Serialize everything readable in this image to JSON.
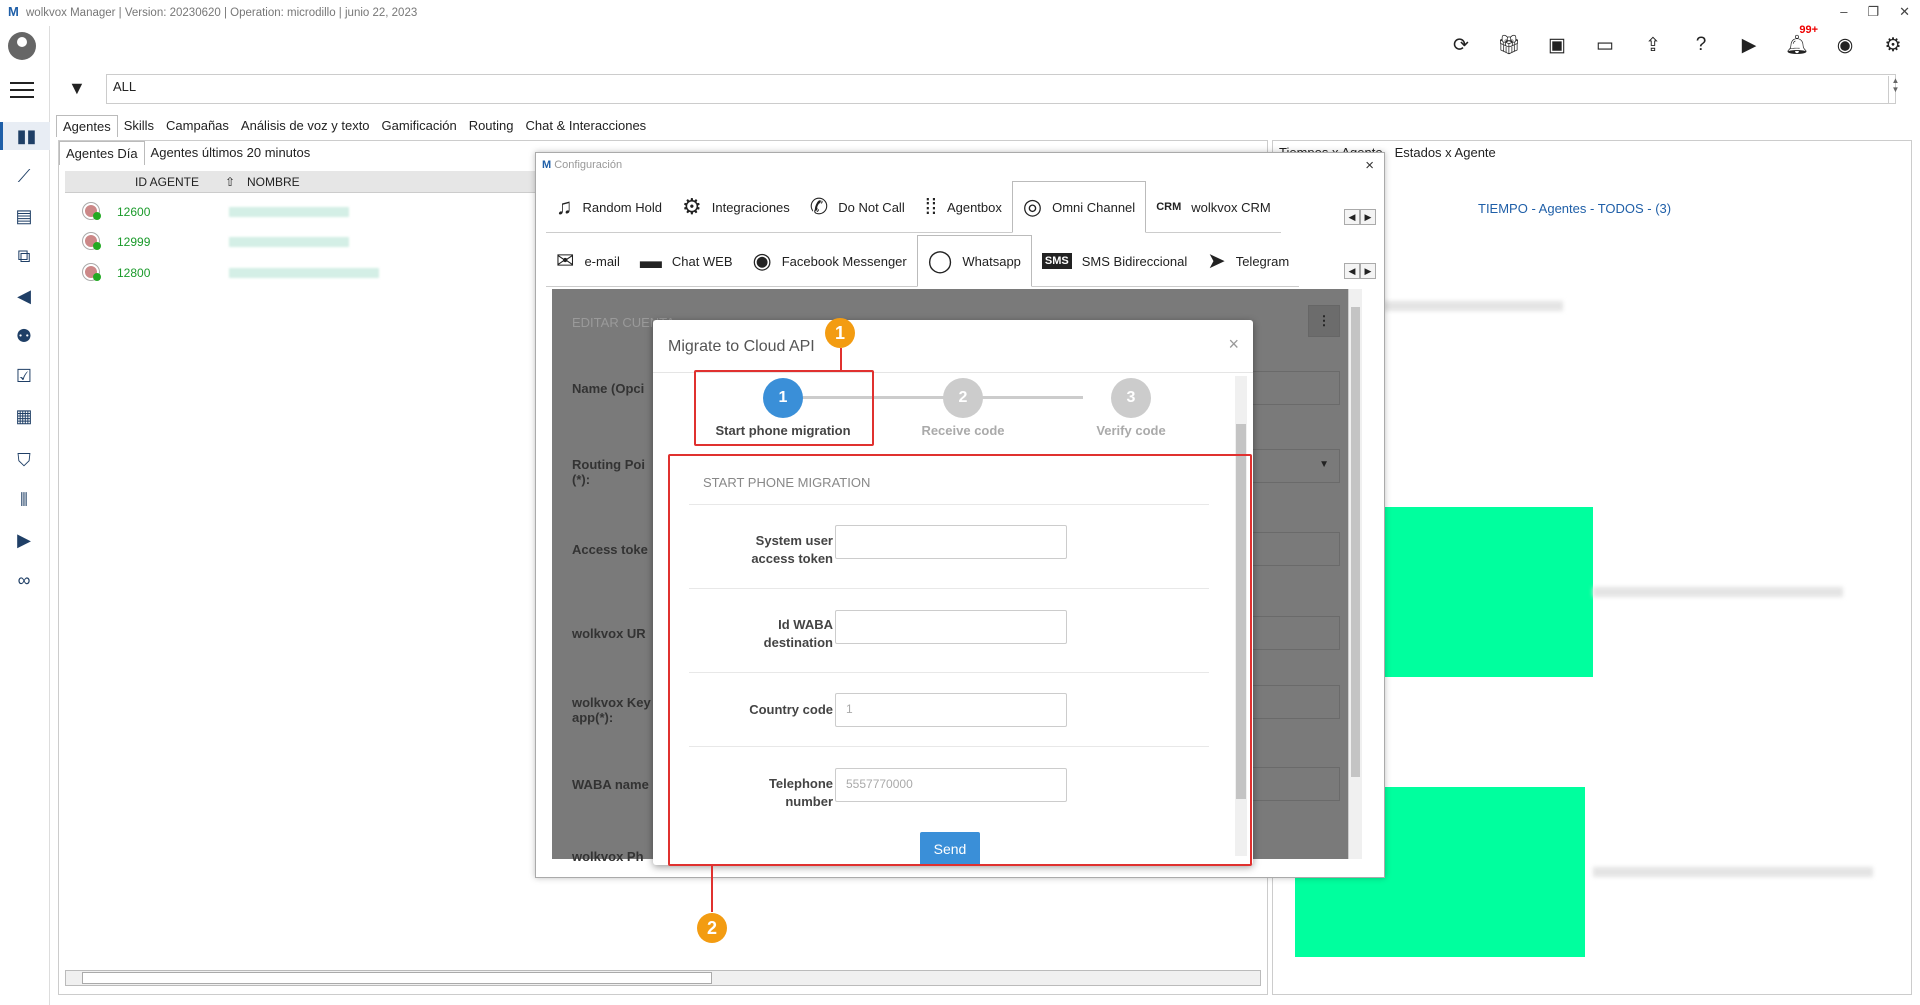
{
  "app": {
    "logo": "M",
    "title": "wolkvox Manager  | Version: 20230620 |  Operation: microdillo  |  junio 22, 2023",
    "window_buttons": [
      "–",
      "❐",
      "✕"
    ]
  },
  "toolbar": {
    "notification_badge": "99+"
  },
  "filter": {
    "value": "ALL"
  },
  "main_tabs": [
    "Agentes",
    "Skills",
    "Campañas",
    "Análisis de voz y texto",
    "Gamificación",
    "Routing",
    "Chat & Interacciones"
  ],
  "left_panel": {
    "subtabs": [
      "Agentes Día",
      "Agentes últimos 20 minutos"
    ],
    "columns": [
      "ID AGENTE",
      "NOMBRE"
    ],
    "rows": [
      {
        "id": "12600"
      },
      {
        "id": "12999"
      },
      {
        "id": "12800"
      }
    ]
  },
  "right_panel": {
    "tabs": [
      "Tiempos x Agente",
      "Estados x Agente"
    ],
    "chart_title": "TIEMPO - Agentes - TODOS -  (3)"
  },
  "config": {
    "title_logo": "M",
    "title": "Configuración",
    "close": "×",
    "tabs_row1": [
      "Random Hold",
      "Integraciones",
      "Do Not Call",
      "Agentbox",
      "Omni Channel",
      "wolkvox CRM"
    ],
    "tabs_row2": [
      "e-mail",
      "Chat WEB",
      "Facebook Messenger",
      "Whatsapp",
      "SMS Bidireccional",
      "Telegram"
    ],
    "body_header": "EDITAR CUENTA",
    "labels": [
      "Name (Opci",
      "Routing Poi\n(*):",
      "Access toke",
      "wolkvox UR",
      "wolkvox Key\napp(*):",
      "WABA name",
      "wolkvox Ph"
    ]
  },
  "modal": {
    "title": "Migrate to Cloud API",
    "close": "×",
    "steps": [
      {
        "number": "1",
        "label": "Start phone migration"
      },
      {
        "number": "2",
        "label": "Receive code"
      },
      {
        "number": "3",
        "label": "Verify code"
      }
    ],
    "section_title": "START PHONE MIGRATION",
    "fields": [
      {
        "label": "System user\naccess token",
        "value": ""
      },
      {
        "label": "Id WABA\ndestination",
        "value": ""
      },
      {
        "label": "Country code",
        "value": "1"
      },
      {
        "label": "Telephone\nnumber",
        "value": "5557770000"
      }
    ],
    "send": "Send"
  },
  "callouts": [
    "1",
    "2"
  ],
  "colors": {
    "accent": "#3a8fd8",
    "highlight": "#e0312f",
    "callout": "#f39c12",
    "chart_bar": "#00ff9e"
  }
}
